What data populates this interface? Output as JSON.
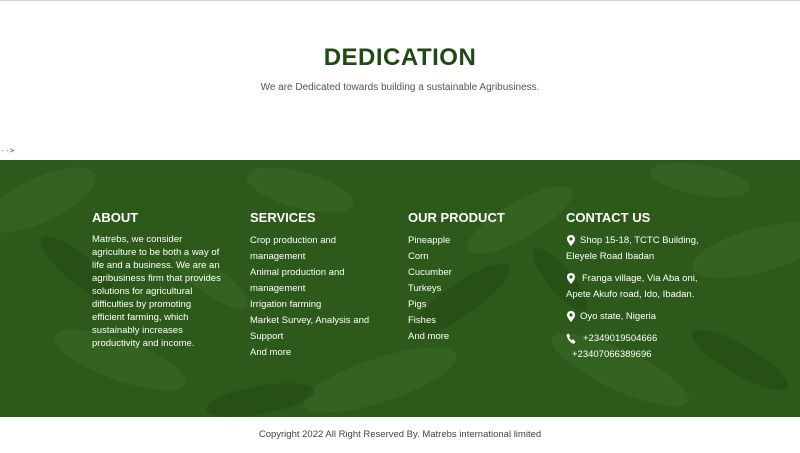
{
  "dedication": {
    "title": "DEDICATION",
    "subtitle": "We are Dedicated towards building a sustainable Agribusiness."
  },
  "stray_text": "-->",
  "footer": {
    "background_color": "#2d5a1b",
    "about": {
      "heading": "ABOUT",
      "text": "Matrebs, we consider agriculture to be both a way of life and a business. We are an agribusiness firm that provides solutions for agricultural difficulties by promoting efficient farming, which sustainably increases productivity and income."
    },
    "services": {
      "heading": "SERVICES",
      "items": [
        {
          "label": "Crop production and management"
        },
        {
          "label": "Animal production and management"
        },
        {
          "label": "Irrigation farming"
        },
        {
          "label": "Market Survey, Analysis and Support"
        },
        {
          "label": "And more"
        }
      ]
    },
    "products": {
      "heading": "OUR PRODUCT",
      "items": [
        {
          "label": "Pineapple"
        },
        {
          "label": "Corn"
        },
        {
          "label": "Cucumber"
        },
        {
          "label": "Turkeys"
        },
        {
          "label": "Pigs"
        },
        {
          "label": "Fishes"
        },
        {
          "label": "And more"
        }
      ]
    },
    "contact": {
      "heading": "CONTACT US",
      "address1": {
        "line1": "Shop 15-18, TCTC Building,",
        "line2": "Eleyele Road Ibadan",
        "icon": "map-marker-icon"
      },
      "address2": {
        "line1": "Franga village, Via Aba oni,",
        "line2": "Apete Akufo road, Ido, Ibadan.",
        "icon": "map-marker-icon"
      },
      "state": {
        "line1": "Oyo state, Nigeria",
        "icon": "map-marker-icon"
      },
      "phone": {
        "line1": "+2349019504666",
        "line2": "+23407066389696",
        "icon": "phone-icon"
      }
    }
  },
  "copyright": "Copyright 2022 All Right Reserved By. Matrebs international limited"
}
